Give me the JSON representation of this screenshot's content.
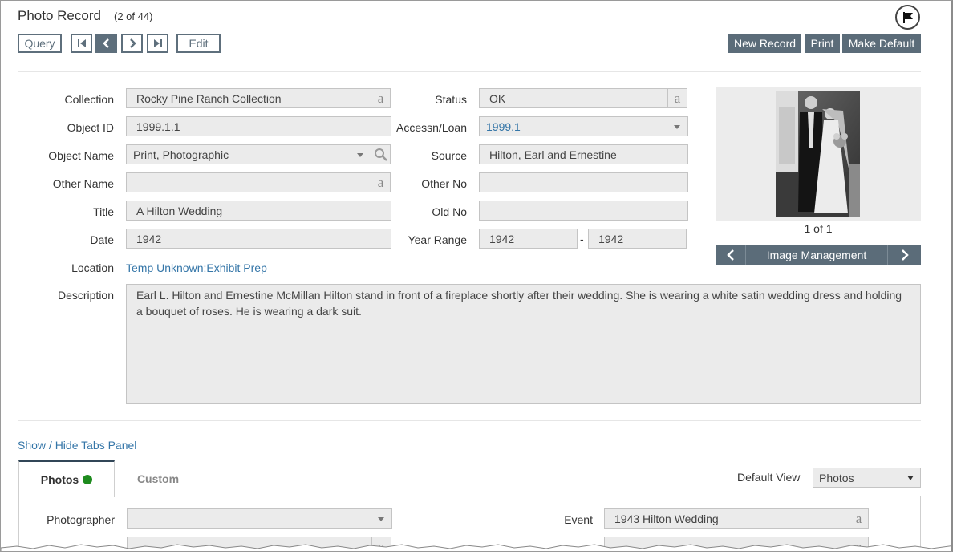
{
  "header": {
    "title": "Photo Record",
    "record_count": "(2 of 44)",
    "flag_icon": "flag-icon"
  },
  "toolbar": {
    "query_label": "Query",
    "edit_label": "Edit",
    "new_record_label": "New Record",
    "print_label": "Print",
    "make_default_label": "Make Default"
  },
  "form": {
    "collection": {
      "label": "Collection",
      "value": "Rocky Pine Ranch Collection"
    },
    "object_id": {
      "label": "Object ID",
      "value": "1999.1.1"
    },
    "object_name": {
      "label": "Object Name",
      "value": "Print, Photographic"
    },
    "other_name": {
      "label": "Other Name",
      "value": ""
    },
    "title": {
      "label": "Title",
      "value": "A Hilton Wedding"
    },
    "date": {
      "label": "Date",
      "value": "1942"
    },
    "location": {
      "label": "Location",
      "value": "Temp Unknown:Exhibit Prep"
    },
    "description": {
      "label": "Description",
      "value": "Earl L. Hilton and Ernestine McMillan Hilton stand in front of a fireplace shortly after their wedding.  She is wearing a white satin wedding dress and holding a bouquet of roses.  He is wearing a dark suit."
    },
    "status": {
      "label": "Status",
      "value": "OK"
    },
    "accession": {
      "label": "Accessn/Loan",
      "value": "1999.1"
    },
    "source": {
      "label": "Source",
      "value": "Hilton, Earl and Ernestine"
    },
    "other_no": {
      "label": "Other No",
      "value": ""
    },
    "old_no": {
      "label": "Old No",
      "value": ""
    },
    "year_range": {
      "label": "Year Range",
      "from": "1942",
      "separator": "-",
      "to": "1942"
    },
    "lexicon_glyph": "a"
  },
  "image": {
    "counter": "1 of 1",
    "management_label": "Image Management"
  },
  "tabs": {
    "toggle_label": "Show / Hide Tabs Panel",
    "items": [
      {
        "label": "Photos",
        "active": true,
        "status_color": "#1e8b1e"
      },
      {
        "label": "Custom",
        "active": false
      }
    ],
    "default_view_label": "Default View",
    "default_view_value": "Photos",
    "photographer": {
      "label": "Photographer",
      "value": ""
    },
    "event": {
      "label": "Event",
      "value": "1943 Hilton Wedding"
    }
  },
  "colors": {
    "button_slate": "#5b6c79",
    "link_blue": "#3576a8",
    "field_bg": "#ebebeb"
  }
}
